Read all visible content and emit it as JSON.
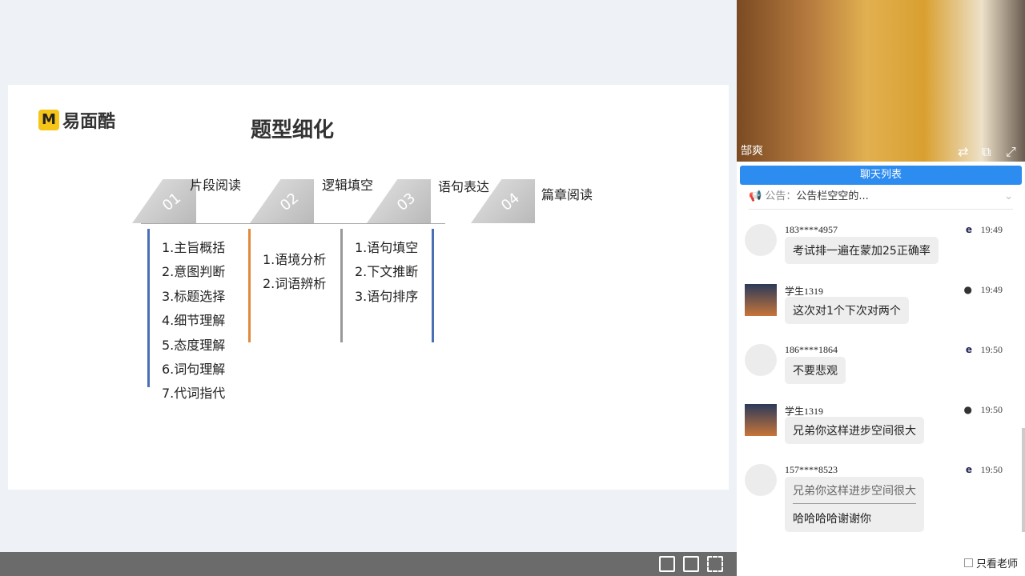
{
  "slide": {
    "logo_letter": "M",
    "logo_text": "易面酷",
    "title": "题型细化",
    "tabs": [
      {
        "num": "01",
        "label": "片段阅读"
      },
      {
        "num": "02",
        "label": "逻辑填空"
      },
      {
        "num": "03",
        "label": "语句表达"
      },
      {
        "num": "04",
        "label": "篇章阅读"
      }
    ],
    "col1": [
      "1.主旨概括",
      "2.意图判断",
      "3.标题选择",
      "4.细节理解",
      "5.态度理解",
      "6.词句理解",
      "7.代词指代"
    ],
    "col2": [
      "1.语境分析",
      "2.词语辨析"
    ],
    "col3": [
      "1.语句填空",
      "2.下文推断",
      "3.语句排序"
    ],
    "colors": {
      "col1": "#4a6fb5",
      "col2": "#e08a3c",
      "col3": "#999999",
      "col4": "#4a6fb5"
    }
  },
  "video": {
    "name": "郜爽"
  },
  "chat": {
    "title": "聊天列表",
    "notice_label": "公告：",
    "notice_text": "公告栏空空的...",
    "messages": [
      {
        "user": "183****4957",
        "time": "19:49",
        "client": "ie",
        "text": "考试排一遍在蒙加25正确率"
      },
      {
        "user": "学生1319",
        "time": "19:49",
        "client": "android",
        "text": "这次对1个下次对两个"
      },
      {
        "user": "186****1864",
        "time": "19:50",
        "client": "ie",
        "text": "不要悲观"
      },
      {
        "user": "学生1319",
        "time": "19:50",
        "client": "android",
        "text": "兄弟你这样进步空间很大"
      },
      {
        "user": "157****8523",
        "time": "19:50",
        "client": "ie",
        "quote": "兄弟你这样进步空间很大",
        "text": "哈哈哈哈谢谢你"
      }
    ],
    "only_teacher": "只看老师"
  }
}
